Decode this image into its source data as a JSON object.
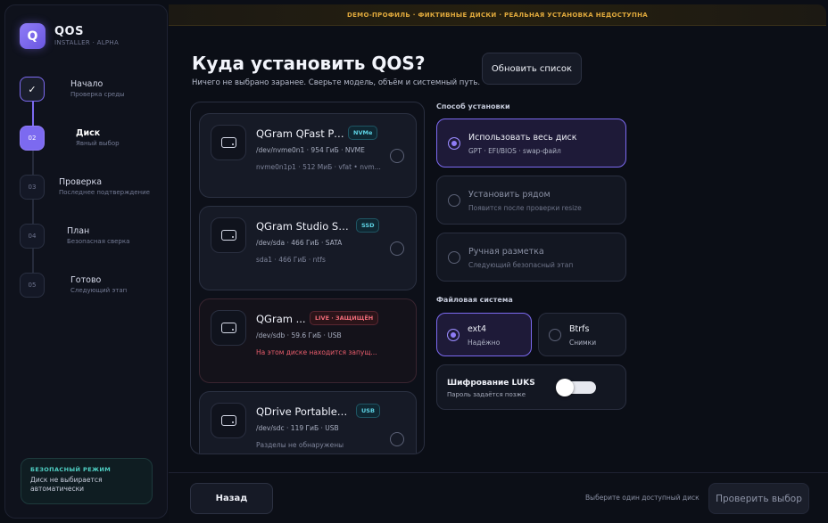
{
  "brand": {
    "logo_letter": "Q",
    "title": "QOS",
    "subtitle": "INSTALLER · ALPHA"
  },
  "steps": [
    {
      "num": "✓",
      "title": "Начало",
      "sub": "Проверка среды",
      "state": "done"
    },
    {
      "num": "02",
      "title": "Диск",
      "sub": "Явный выбор",
      "state": "active"
    },
    {
      "num": "03",
      "title": "Проверка",
      "sub": "Последнее подтверждение",
      "state": "todo"
    },
    {
      "num": "04",
      "title": "План",
      "sub": "Безопасная сверка",
      "state": "todo"
    },
    {
      "num": "05",
      "title": "Готово",
      "sub": "Следующий этап",
      "state": "todo"
    }
  ],
  "safe_mode": {
    "title": "БЕЗОПАСНЫЙ РЕЖИМ",
    "text": "Диск не выбирается автоматически"
  },
  "banner": "DEMO-ПРОФИЛЬ · ФИКТИВНЫЕ ДИСКИ · РЕАЛЬНАЯ УСТАНОВКА НЕДОСТУПНА",
  "header": {
    "title": "Куда установить QOS?",
    "subtitle": "Ничего не выбрано заранее. Сверьте модель, объём и системный путь.",
    "refresh_label": "Обновить список"
  },
  "disks": [
    {
      "name": "QGram QFast Pr...",
      "badge": "NVMe",
      "badge_kind": "blue",
      "meta": "/dev/nvme0n1 · 954 ГиБ · NVME",
      "parts": "nvme0n1p1 · 512 МиБ · vfat • nvm...",
      "warning": ""
    },
    {
      "name": "QGram Studio SSD",
      "badge": "SSD",
      "badge_kind": "blue",
      "meta": "/dev/sda · 466 ГиБ · SATA",
      "parts": "sda1 · 466 ГиБ · ntfs",
      "warning": ""
    },
    {
      "name": "QGram ...",
      "badge": "LIVE · ЗАЩИЩЁН",
      "badge_kind": "red",
      "meta": "/dev/sdb · 59.6 ГиБ · USB",
      "parts": "",
      "warning": "На этом диске находится запущ..."
    },
    {
      "name": "QDrive Portable S...",
      "badge": "USB",
      "badge_kind": "blue",
      "meta": "/dev/sdc · 119 ГиБ · USB",
      "parts": "Разделы не обнаружены",
      "warning": ""
    }
  ],
  "install_method": {
    "label": "Способ установки",
    "options": [
      {
        "title": "Использовать весь диск",
        "sub": "GPT · EFI/BIOS · swap-файл",
        "selected": true,
        "disabled": false
      },
      {
        "title": "Установить рядом",
        "sub": "Появится после проверки resize",
        "selected": false,
        "disabled": true
      },
      {
        "title": "Ручная разметка",
        "sub": "Следующий безопасный этап",
        "selected": false,
        "disabled": true
      }
    ]
  },
  "filesystem": {
    "label": "Файловая система",
    "options": [
      {
        "title": "ext4",
        "sub": "Надёжно",
        "selected": true
      },
      {
        "title": "Btrfs",
        "sub": "Снимки",
        "selected": false
      }
    ]
  },
  "luks": {
    "title": "Шифрование LUKS",
    "sub": "Пароль задаётся позже",
    "enabled": false
  },
  "footer": {
    "back_label": "Назад",
    "hint": "Выберите один доступный диск",
    "next_label": "Проверить выбор"
  }
}
